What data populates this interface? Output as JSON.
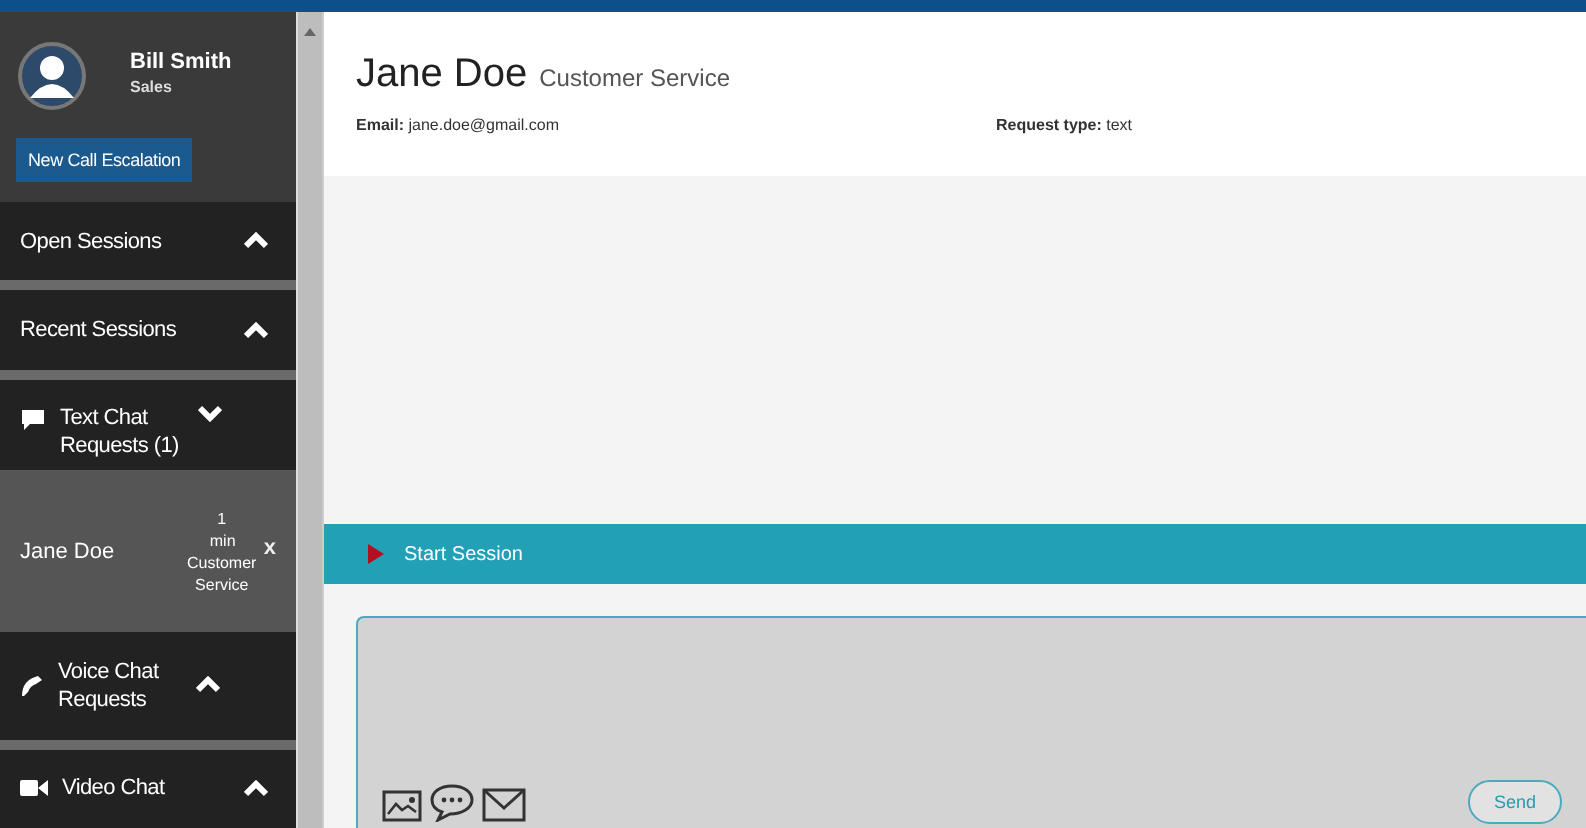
{
  "user": {
    "name": "Bill Smith",
    "department": "Sales"
  },
  "escalation_button": "New Call Escalation",
  "sections": [
    {
      "label": "Open Sessions",
      "kind": "plain",
      "expanded": false
    },
    {
      "label": "Recent Sessions",
      "kind": "plain",
      "expanded": false
    },
    {
      "label": "Text Chat Requests (1)",
      "kind": "text",
      "expanded": true,
      "requests": [
        {
          "name": "Jane Doe",
          "wait": "1 min",
          "queue": "Customer Service",
          "close": "x"
        }
      ]
    },
    {
      "label": "Voice Chat Requests",
      "kind": "voice",
      "expanded": false
    },
    {
      "label": "Video Chat",
      "kind": "video",
      "expanded": false
    }
  ],
  "customer": {
    "name": "Jane Doe",
    "queue": "Customer Service",
    "email_label": "Email:",
    "email": "jane.doe@gmail.com",
    "request_type_label": "Request type:",
    "request_type": "text"
  },
  "session_bar": {
    "label": "Start Session"
  },
  "composer": {
    "send_button": "Send"
  }
}
